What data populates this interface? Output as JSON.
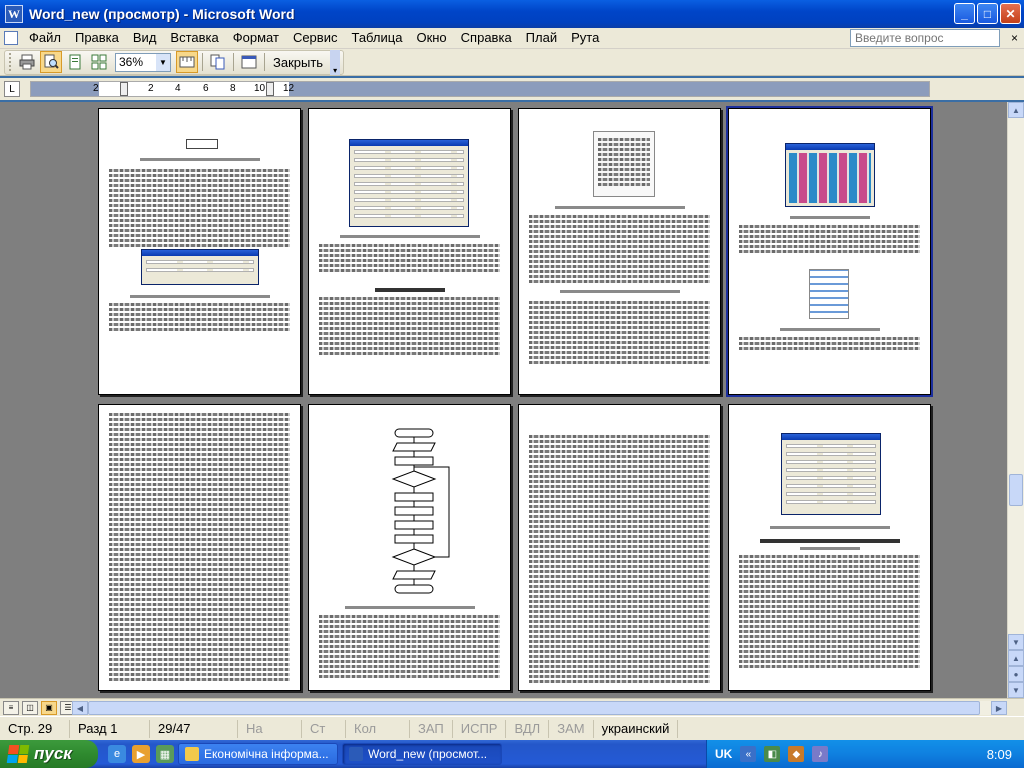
{
  "window": {
    "title": "Word_new (просмотр) - Microsoft Word",
    "icon_letter": "W",
    "buttons": {
      "minimize": "_",
      "maximize": "□",
      "close": "✕"
    }
  },
  "menu": {
    "items": [
      "Файл",
      "Правка",
      "Вид",
      "Вставка",
      "Формат",
      "Сервис",
      "Таблица",
      "Окно",
      "Справка",
      "Плай",
      "Рута"
    ],
    "help_placeholder": "Введите вопрос",
    "close_doc": "×"
  },
  "toolbar": {
    "zoom": "36%",
    "close_label": "Закрыть"
  },
  "ruler": {
    "ticks": [
      "2",
      "2",
      "4",
      "6",
      "8",
      "10",
      "12"
    ],
    "corner": "L"
  },
  "status": {
    "page": "Стр. 29",
    "section": "Разд 1",
    "pages": "29/47",
    "at": "На",
    "line": "Ст",
    "col": "Кол",
    "rec": "ЗАП",
    "trk": "ИСПР",
    "ext": "ВДЛ",
    "ovr": "ЗАМ",
    "language": "украинский"
  },
  "taskbar": {
    "start": "пуск",
    "tasks": [
      {
        "label": "Економічна інформа...",
        "icon": "folder-icon",
        "color": "#f2c94c"
      },
      {
        "label": "Word_new (просмот...",
        "icon": "word-icon",
        "color": "#2b5bb8"
      }
    ],
    "lang": "UK",
    "time": "8:09"
  }
}
